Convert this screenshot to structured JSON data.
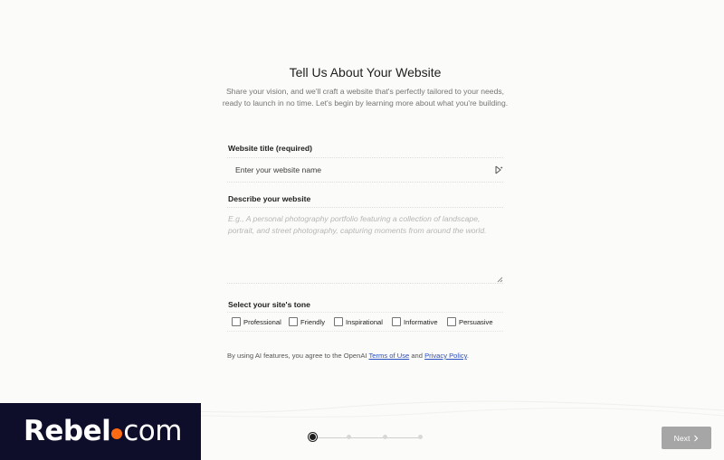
{
  "header": {
    "title": "Tell Us About Your Website",
    "subtitle": "Share your vision, and we'll craft a website that's perfectly tailored to your needs, ready to launch in no time. Let's begin by learning more about what you're building."
  },
  "website_title": {
    "label": "Website title (required)",
    "value": "",
    "placeholder": "Enter your website name",
    "icon": "ai-sparkle-icon"
  },
  "description": {
    "label": "Describe your website",
    "value": "",
    "placeholder": "E.g., A personal photography portfolio featuring a collection of landscape, portrait, and street photography, capturing moments from around the world."
  },
  "tone": {
    "label": "Select your site's tone",
    "options": [
      {
        "label": "Professional",
        "checked": false
      },
      {
        "label": "Friendly",
        "checked": false
      },
      {
        "label": "Inspirational",
        "checked": false
      },
      {
        "label": "Informative",
        "checked": false
      },
      {
        "label": "Persuasive",
        "checked": false
      }
    ]
  },
  "consent": {
    "prefix": "By using AI features, you agree to the OpenAI ",
    "terms_link": "Terms of Use",
    "and": " and ",
    "privacy_link": "Privacy Policy",
    "suffix": "."
  },
  "brand": {
    "name_bold": "Rebel",
    "name_regular": "com",
    "dot_color": "#ff6a13",
    "background": "#0f0e2a"
  },
  "stepper": {
    "total_steps": 4,
    "current_step": 1
  },
  "footer": {
    "next_label": "Next",
    "next_icon": "chevron-right-icon"
  }
}
